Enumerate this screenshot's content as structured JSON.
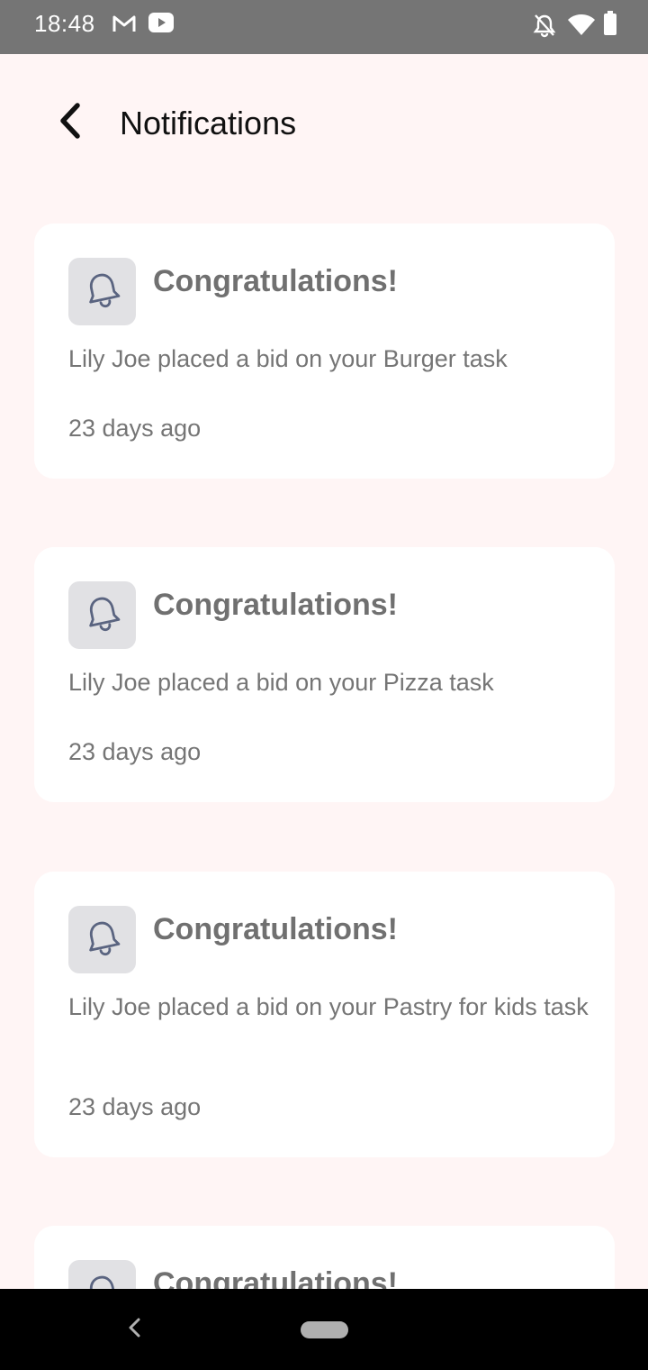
{
  "status_bar": {
    "time": "18:48",
    "left_icons": [
      "gmail-icon",
      "youtube-icon"
    ],
    "right_icons": [
      "notifications-off-icon",
      "wifi-icon",
      "battery-icon"
    ]
  },
  "header": {
    "back_icon": "chevron-left-icon",
    "title": "Notifications"
  },
  "notifications": [
    {
      "icon": "bell-icon",
      "title": "Congratulations!",
      "message": "Lily Joe placed a bid on your Burger task",
      "time": "23 days ago"
    },
    {
      "icon": "bell-icon",
      "title": "Congratulations!",
      "message": "Lily Joe placed a bid on your Pizza task",
      "time": "23 days ago"
    },
    {
      "icon": "bell-icon",
      "title": "Congratulations!",
      "message": "Lily Joe placed a bid on your Pastry for kids task",
      "time": "23 days ago"
    },
    {
      "icon": "bell-icon",
      "title": "Congratulations!"
    }
  ],
  "nav_bar": {
    "icons": [
      "nav-back-icon",
      "nav-home-pill"
    ]
  },
  "colors": {
    "background": "#fff5f5",
    "card": "#ffffff",
    "status_bar": "#757575",
    "icon_tile": "#e1e1e4",
    "bell": "#5a6480",
    "title_text": "#707070",
    "body_text": "#757575"
  }
}
